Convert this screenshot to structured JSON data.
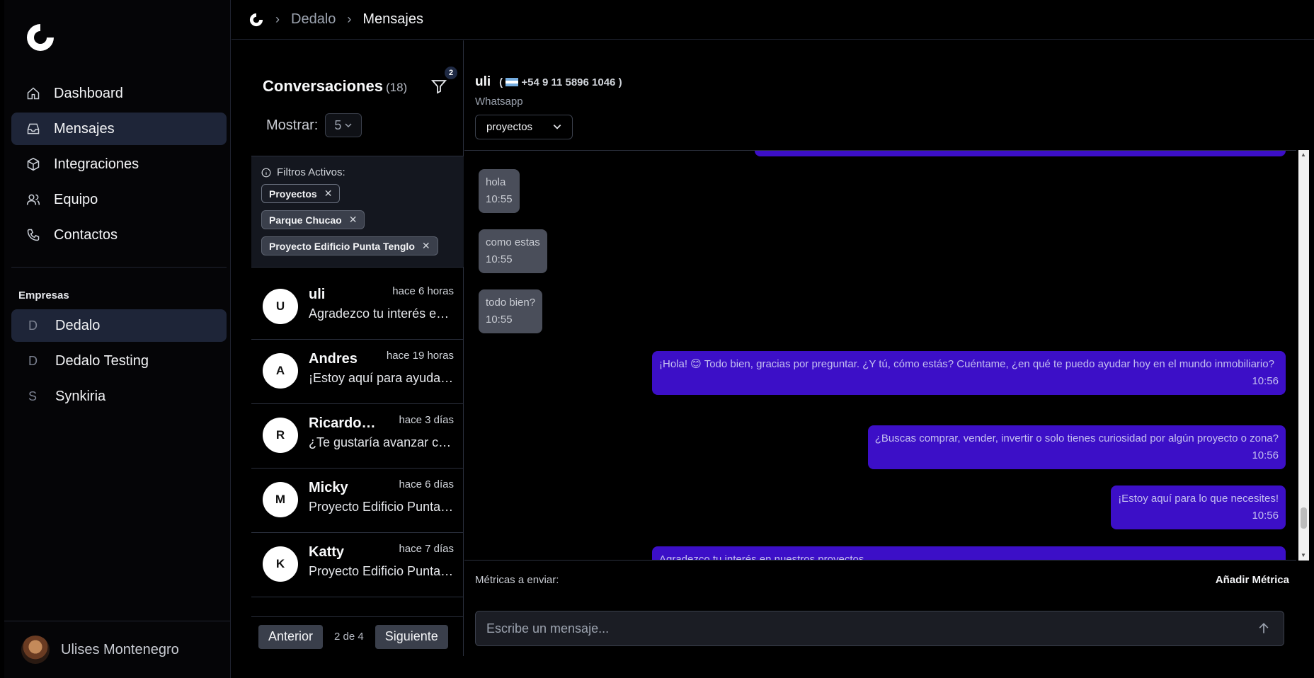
{
  "sidebar": {
    "nav": [
      {
        "label": "Dashboard",
        "icon": "home-icon"
      },
      {
        "label": "Mensajes",
        "icon": "inbox-icon"
      },
      {
        "label": "Integraciones",
        "icon": "cube-icon"
      },
      {
        "label": "Equipo",
        "icon": "users-icon"
      },
      {
        "label": "Contactos",
        "icon": "phone-icon"
      }
    ],
    "companies_label": "Empresas",
    "companies": [
      {
        "letter": "D",
        "label": "Dedalo"
      },
      {
        "letter": "D",
        "label": "Dedalo Testing"
      },
      {
        "letter": "S",
        "label": "Synkiria"
      }
    ],
    "user_name": "Ulises Montenegro"
  },
  "breadcrumb": {
    "items": [
      "Dedalo",
      "Mensajes"
    ]
  },
  "conversations": {
    "title": "Conversaciones",
    "count": "(18)",
    "filter_badge": "2",
    "show_label": "Mostrar:",
    "show_value": "5",
    "filters_label": "Filtros Activos:",
    "active_filters": [
      "Proyectos",
      "Parque Chucao",
      "Proyecto Edificio Punta Tenglo"
    ],
    "items": [
      {
        "initial": "U",
        "name": "uli",
        "time": "hace 6 horas",
        "preview": "Agradezco tu interés en nuestros proyectos"
      },
      {
        "initial": "A",
        "name": "Andres",
        "time": "hace 19 horas",
        "preview": "¡Estoy aquí para ayudarte!"
      },
      {
        "initial": "R",
        "name": "Ricardo Fuentes",
        "time": "hace 3 días",
        "preview": "¿Te gustaría avanzar con la cotización?"
      },
      {
        "initial": "M",
        "name": "Micky",
        "time": "hace 6 días",
        "preview": "Proyecto Edificio Punta Tenglo"
      },
      {
        "initial": "K",
        "name": "Katty",
        "time": "hace 7 días",
        "preview": "Proyecto Edificio Punta Tenglo"
      }
    ],
    "pager": {
      "prev": "Anterior",
      "info": "2 de 4",
      "next": "Siguiente"
    }
  },
  "chat": {
    "name": "uli",
    "phone": "+54 9 11 5896 1046",
    "channel": "Whatsapp",
    "tag": "proyectos",
    "messages": [
      {
        "dir": "in",
        "text": "hola",
        "time": "10:55"
      },
      {
        "dir": "in",
        "text": "como estas",
        "time": "10:55"
      },
      {
        "dir": "in",
        "text": "todo bien?",
        "time": "10:55"
      },
      {
        "dir": "out",
        "text": "¡Hola! 😊 Todo bien, gracias por preguntar. ¿Y tú, cómo estás? Cuéntame, ¿en qué te puedo ayudar hoy en el mundo inmobiliario?",
        "time": "10:56"
      },
      {
        "dir": "out",
        "text": "¿Buscas comprar, vender, invertir o solo tienes curiosidad por algún proyecto o zona?",
        "time": "10:56"
      },
      {
        "dir": "out",
        "text": "¡Estoy aquí para lo que necesites!",
        "time": "10:56"
      },
      {
        "dir": "out",
        "text": "Agradezco tu interés en nuestros proyectos",
        "time": ""
      }
    ],
    "metrics_label": "Métricas a enviar:",
    "metrics_add": "Añadir Métrica",
    "composer_placeholder": "Escribe un mensaje..."
  }
}
